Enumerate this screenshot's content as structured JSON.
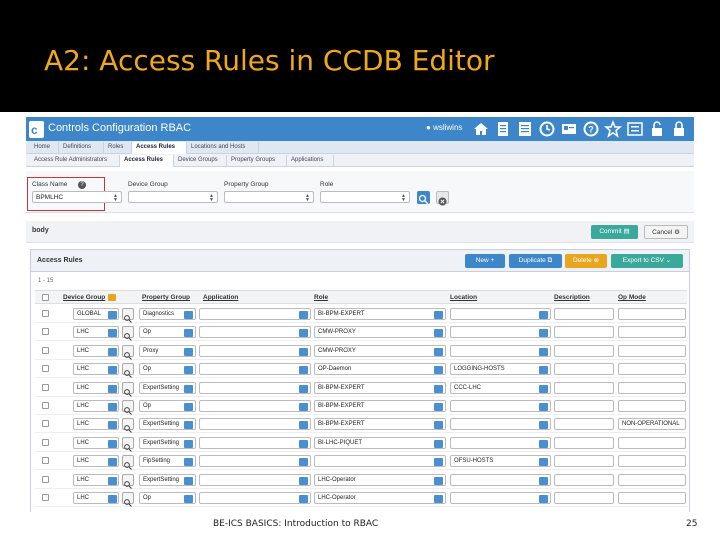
{
  "slide": {
    "title": "A2: Access Rules in CCDB Editor",
    "footer_text": "BE-ICS BASICS: Introduction to RBAC",
    "page_number": "25"
  },
  "app": {
    "name": "Controls Configuration RBAC",
    "user": "wsliwins",
    "toolbar_icons": [
      "home-icon",
      "document-icon",
      "list-icon",
      "clock-icon",
      "card-icon",
      "help-icon",
      "star-icon",
      "settings-icon",
      "lock-icon"
    ]
  },
  "tabs_primary": [
    {
      "label": "Home"
    },
    {
      "label": "Definitions"
    },
    {
      "label": "Roles"
    },
    {
      "label": "Access Rules",
      "active": true
    },
    {
      "label": "Locations and Hosts"
    }
  ],
  "tabs_secondary": [
    {
      "label": "Access Rule Administrators"
    },
    {
      "label": "Access Rules",
      "active": true
    },
    {
      "label": "Device Groups"
    },
    {
      "label": "Property Groups"
    },
    {
      "label": "Applications"
    }
  ],
  "filter": {
    "class_name_label": "Class Name",
    "class_name_value": "BPMLHC",
    "device_group_label": "Device Group",
    "property_group_label": "Property Group",
    "role_label": "Role",
    "help_glyph": "?"
  },
  "body_bar": {
    "label": "body",
    "commit_label": "Commit",
    "cancel_label": "Cancel"
  },
  "panel": {
    "title": "Access Rules",
    "new_label": "New",
    "duplicate_label": "Duplicate",
    "delete_label": "Delete",
    "export_label": "Export to CSV",
    "count": "1 - 15",
    "colors": {
      "blue": "#4a8fd0",
      "orange": "#e8a51e",
      "teal": "#3aa89a"
    }
  },
  "table": {
    "headers": {
      "device_group": "Device Group",
      "property_group": "Property Group",
      "application": "Application",
      "role": "Role",
      "location": "Location",
      "description": "Description",
      "op_mode": "Op Mode"
    },
    "rows": [
      {
        "device": "GLOBAL",
        "property": "Diagnostics",
        "application": "",
        "role": "BI-BPM-EXPERT",
        "location": "",
        "description": "",
        "op_mode": ""
      },
      {
        "device": "LHC",
        "property": "Op",
        "application": "",
        "role": "CMW-PROXY",
        "location": "",
        "description": "",
        "op_mode": ""
      },
      {
        "device": "LHC",
        "property": "Proxy",
        "application": "",
        "role": "CMW-PROXY",
        "location": "",
        "description": "",
        "op_mode": ""
      },
      {
        "device": "LHC",
        "property": "Op",
        "application": "",
        "role": "OP-Daemon",
        "location": "LOGGING-HOSTS",
        "description": "",
        "op_mode": ""
      },
      {
        "device": "LHC",
        "property": "ExpertSetting",
        "application": "",
        "role": "BI-BPM-EXPERT",
        "location": "CCC-LHC",
        "description": "",
        "op_mode": ""
      },
      {
        "device": "LHC",
        "property": "Op",
        "application": "",
        "role": "BI-BPM-EXPERT",
        "location": "",
        "description": "",
        "op_mode": ""
      },
      {
        "device": "LHC",
        "property": "ExpertSetting",
        "application": "",
        "role": "BI-BPM-EXPERT",
        "location": "",
        "description": "",
        "op_mode": "NON-OPERATIONAL"
      },
      {
        "device": "LHC",
        "property": "ExpertSetting",
        "application": "",
        "role": "BI-LHC-PIQUET",
        "location": "",
        "description": "",
        "op_mode": ""
      },
      {
        "device": "LHC",
        "property": "FipSetting",
        "application": "",
        "role": "",
        "location": "OFSU-HOSTS",
        "description": "",
        "op_mode": ""
      },
      {
        "device": "LHC",
        "property": "ExpertSetting",
        "application": "",
        "role": "LHC-Operator",
        "location": "",
        "description": "",
        "op_mode": ""
      },
      {
        "device": "LHC",
        "property": "Op",
        "application": "",
        "role": "LHC-Operator",
        "location": "",
        "description": "",
        "op_mode": ""
      }
    ]
  }
}
